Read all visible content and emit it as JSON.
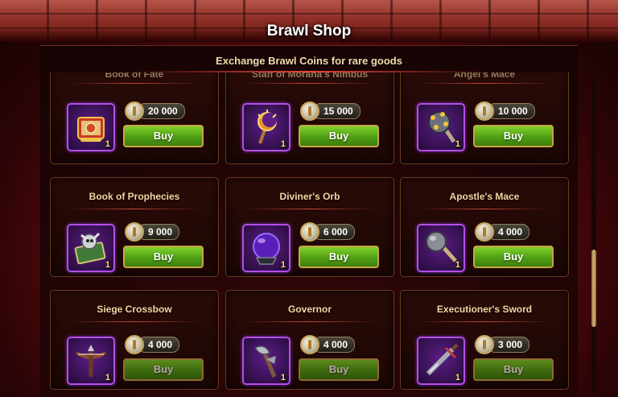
{
  "header": {
    "title": "Brawl Shop"
  },
  "panel": {
    "subtitle": "Exchange Brawl Coins for rare goods"
  },
  "items": [
    {
      "name": "Book of Fate",
      "price": "20 000",
      "qty": "1",
      "buy_label": "Buy",
      "icon": "book-icon"
    },
    {
      "name": "Staff of Morana's Nimbus",
      "price": "15 000",
      "qty": "1",
      "buy_label": "Buy",
      "icon": "staff-icon"
    },
    {
      "name": "Angel's Mace",
      "price": "10 000",
      "qty": "1",
      "buy_label": "Buy",
      "icon": "mace-icon"
    },
    {
      "name": "Book of Prophecies",
      "price": "9 000",
      "qty": "1",
      "buy_label": "Buy",
      "icon": "book-icon"
    },
    {
      "name": "Diviner's Orb",
      "price": "6 000",
      "qty": "1",
      "buy_label": "Buy",
      "icon": "orb-icon"
    },
    {
      "name": "Apostle's Mace",
      "price": "4 000",
      "qty": "1",
      "buy_label": "Buy",
      "icon": "mace-icon"
    },
    {
      "name": "Siege Crossbow",
      "price": "4 000",
      "qty": "1",
      "buy_label": "Buy",
      "icon": "crossbow-icon"
    },
    {
      "name": "Governor",
      "price": "4 000",
      "qty": "1",
      "buy_label": "Buy",
      "icon": "axe-icon"
    },
    {
      "name": "Executioner's Sword",
      "price": "3 000",
      "qty": "1",
      "buy_label": "Buy",
      "icon": "sword-icon"
    }
  ],
  "colors": {
    "accent": "#b14fe6",
    "buy": "#5aa91a",
    "title_text": "#f3d7a2"
  }
}
